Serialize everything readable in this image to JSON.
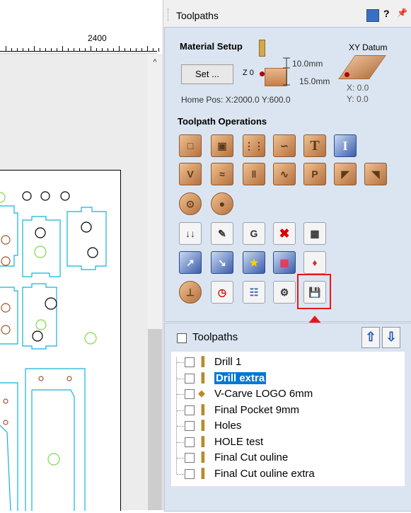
{
  "panel": {
    "title": "Toolpaths",
    "help_label": "?",
    "pin_label": "↕"
  },
  "ruler": {
    "label": "2400"
  },
  "material_setup": {
    "title": "Material Setup",
    "set_button": "Set ...",
    "z_label": "Z 0",
    "top_dim": "10.0mm",
    "bottom_dim": "15.0mm",
    "home_pos": "Home Pos:  X:2000.0 Y:600.0"
  },
  "xy_datum": {
    "title": "XY Datum",
    "x": "X: 0.0",
    "y": "Y: 0.0"
  },
  "operations": {
    "title": "Toolpath Operations"
  },
  "toolpaths_list": {
    "title": "Toolpaths",
    "up_icon": "arrow-up-icon",
    "down_icon": "arrow-down-icon",
    "items": [
      {
        "label": "Drill 1",
        "icon": "drill-icon",
        "selected": false
      },
      {
        "label": "Drill extra",
        "icon": "drill-icon",
        "selected": true
      },
      {
        "label": "V-Carve LOGO 6mm",
        "icon": "vcarve-icon",
        "selected": false
      },
      {
        "label": "Final Pocket 9mm",
        "icon": "endmill-icon",
        "selected": false
      },
      {
        "label": "Holes",
        "icon": "endmill-icon",
        "selected": false
      },
      {
        "label": "HOLE test",
        "icon": "endmill-icon",
        "selected": false
      },
      {
        "label": "Final Cut ouline",
        "icon": "endmill-icon",
        "selected": false
      },
      {
        "label": "Final Cut ouline extra",
        "icon": "endmill-icon",
        "selected": false
      }
    ]
  },
  "colors": {
    "panel_bg": "#dbe5f1",
    "accent": "#0078d7",
    "highlight": "#e8171d"
  }
}
